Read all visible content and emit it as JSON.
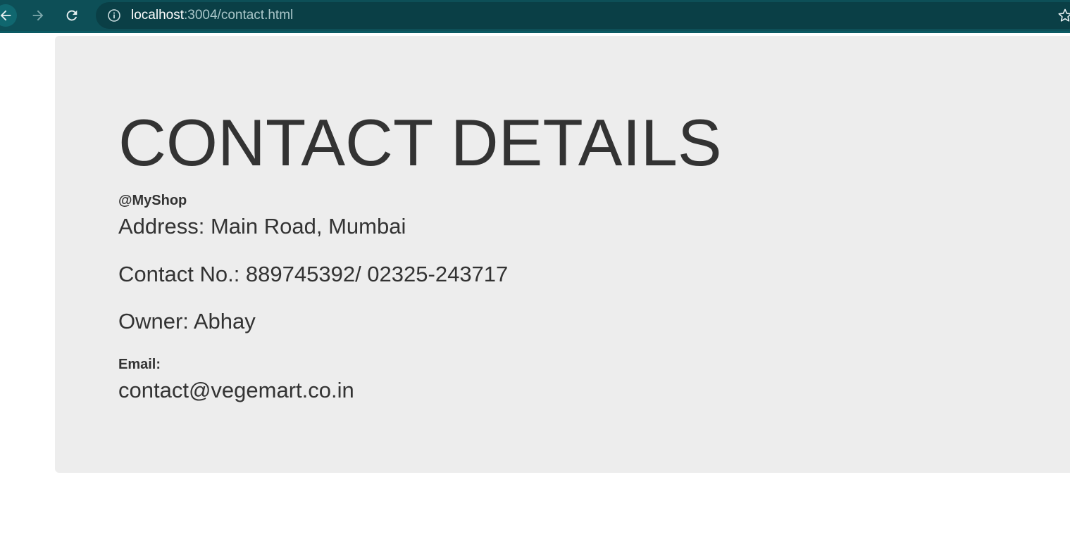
{
  "browser": {
    "url_host": "localhost",
    "url_path": ":3004/contact.html",
    "icons": {
      "back": "back-arrow-icon",
      "forward": "forward-arrow-icon",
      "reload": "reload-icon",
      "info": "info-icon",
      "bookmark": "star-icon"
    },
    "colors": {
      "toolbar": "#0d4f57",
      "omnibox": "#0a3f46"
    }
  },
  "contact": {
    "title": "CONTACT DETAILS",
    "handle": "@MyShop",
    "address": "Address: Main Road, Mumbai",
    "phone": "Contact No.: 889745392/ 02325-243717",
    "owner": "Owner: Abhay",
    "email_label": "Email:",
    "email": "contact@vegemart.co.in"
  },
  "colors": {
    "panel": "#ededed",
    "text": "#333333"
  }
}
